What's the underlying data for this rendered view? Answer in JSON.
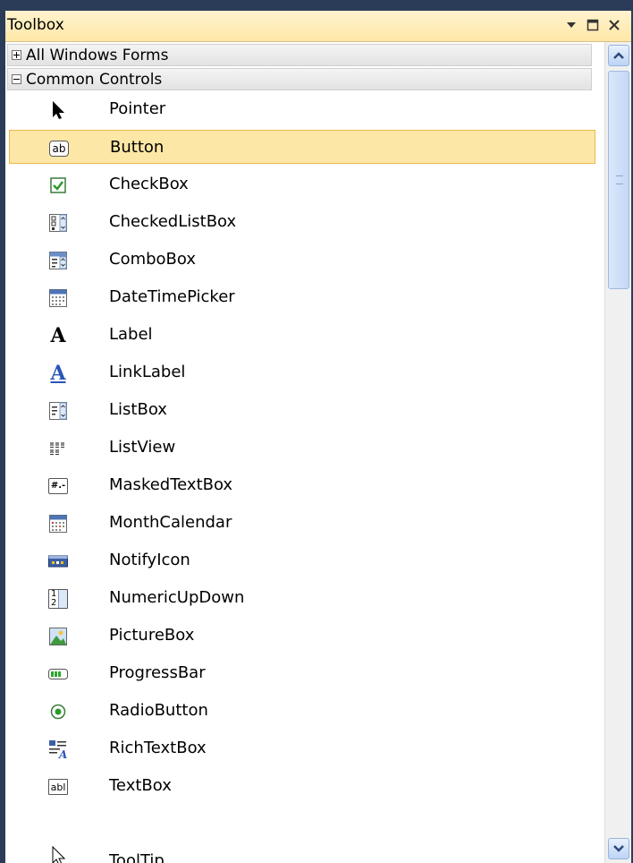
{
  "toolbox": {
    "title": "Toolbox",
    "buttons": {
      "pin": "dropdown-arrow-icon",
      "maximize": "window-maximize-icon",
      "close": "close-icon"
    }
  },
  "groups": {
    "all_windows_forms": {
      "label": "All Windows Forms",
      "state": "collapsed"
    },
    "common_controls": {
      "label": "Common Controls",
      "state": "expanded"
    }
  },
  "items": [
    {
      "label": "Pointer",
      "icon": "pointer-arrow-icon"
    },
    {
      "label": "Button",
      "icon": "button-icon",
      "selected": true
    },
    {
      "label": "CheckBox",
      "icon": "checkbox-icon"
    },
    {
      "label": "CheckedListBox",
      "icon": "checked-listbox-icon"
    },
    {
      "label": "ComboBox",
      "icon": "combobox-icon"
    },
    {
      "label": "DateTimePicker",
      "icon": "datetimepicker-icon"
    },
    {
      "label": "Label",
      "icon": "label-icon"
    },
    {
      "label": "LinkLabel",
      "icon": "linklabel-icon"
    },
    {
      "label": "ListBox",
      "icon": "listbox-icon"
    },
    {
      "label": "ListView",
      "icon": "listview-icon"
    },
    {
      "label": "MaskedTextBox",
      "icon": "maskedtextbox-icon"
    },
    {
      "label": "MonthCalendar",
      "icon": "monthcalendar-icon"
    },
    {
      "label": "NotifyIcon",
      "icon": "notifyicon-icon"
    },
    {
      "label": "NumericUpDown",
      "icon": "numericupdown-icon"
    },
    {
      "label": "PictureBox",
      "icon": "picturebox-icon"
    },
    {
      "label": "ProgressBar",
      "icon": "progressbar-icon"
    },
    {
      "label": "RadioButton",
      "icon": "radiobutton-icon"
    },
    {
      "label": "RichTextBox",
      "icon": "richtextbox-icon"
    },
    {
      "label": "TextBox",
      "icon": "textbox-icon"
    },
    {
      "label": "ToolTip",
      "icon": "tooltip-icon"
    }
  ],
  "icon_text": {
    "button": "ab",
    "textbox": "abl",
    "label": "A",
    "linklabel": "A",
    "maskedtextbox": "#.-",
    "numeric_top": "1",
    "numeric_bottom": "2"
  },
  "scrollbar": {
    "up": "scroll-up-icon",
    "down": "scroll-down-icon"
  },
  "colors": {
    "title_bg": "#ffe7a6",
    "selected_bg": "#fde7a6",
    "selected_border": "#e8b94a",
    "frame": "#2b3c59"
  }
}
